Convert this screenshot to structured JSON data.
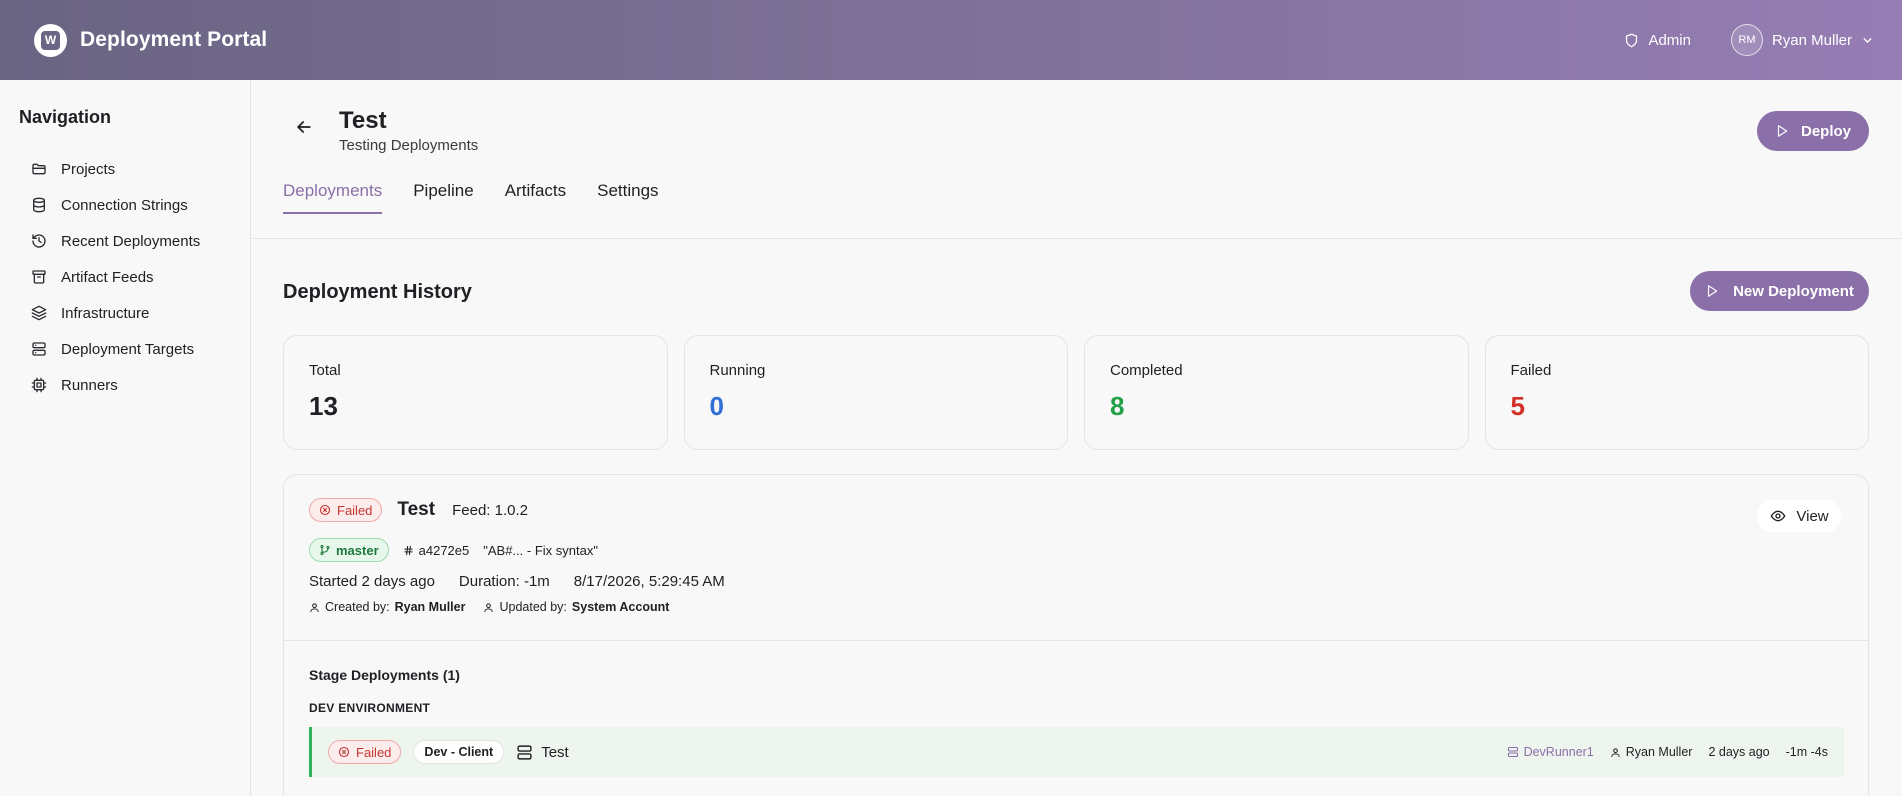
{
  "header": {
    "brand_letter": "W",
    "title": "Deployment Portal",
    "admin_label": "Admin",
    "user_initials": "RM",
    "user_name": "Ryan Muller"
  },
  "sidebar": {
    "title": "Navigation",
    "items": [
      {
        "label": "Projects",
        "icon": "folder-icon"
      },
      {
        "label": "Connection Strings",
        "icon": "database-icon"
      },
      {
        "label": "Recent Deployments",
        "icon": "history-icon"
      },
      {
        "label": "Artifact Feeds",
        "icon": "archive-icon"
      },
      {
        "label": "Infrastructure",
        "icon": "layers-icon"
      },
      {
        "label": "Deployment Targets",
        "icon": "server-icon"
      },
      {
        "label": "Runners",
        "icon": "cpu-icon"
      }
    ]
  },
  "page": {
    "title": "Test",
    "subtitle": "Testing Deployments",
    "deploy_label": "Deploy",
    "tabs": [
      "Deployments",
      "Pipeline",
      "Artifacts",
      "Settings"
    ],
    "active_tab": "Deployments"
  },
  "history": {
    "title": "Deployment History",
    "new_deployment_label": "New Deployment",
    "stats": [
      {
        "label": "Total",
        "value": "13",
        "color": "#1f1f24"
      },
      {
        "label": "Running",
        "value": "0",
        "color": "#2f6fd6"
      },
      {
        "label": "Completed",
        "value": "8",
        "color": "#22a04a"
      },
      {
        "label": "Failed",
        "value": "5",
        "color": "#d22f27"
      }
    ]
  },
  "deployment": {
    "status": "Failed",
    "name": "Test",
    "feed": "Feed: 1.0.2",
    "branch": "master",
    "commit_hash": "a4272e5",
    "commit_message": "\"AB#... - Fix syntax\"",
    "started": "Started 2 days ago",
    "duration": "Duration: -1m",
    "timestamp": "8/17/2026, 5:29:45 AM",
    "created_by_label": "Created by:",
    "created_by": "Ryan Muller",
    "updated_by_label": "Updated by:",
    "updated_by": "System Account",
    "view_label": "View",
    "stages_title": "Stage Deployments (1)",
    "environment": "DEV ENVIRONMENT",
    "stage": {
      "status": "Failed",
      "env_badge": "Dev - Client",
      "target": "Test",
      "runner": "DevRunner1",
      "user": "Ryan Muller",
      "time": "2 days ago",
      "duration": "-1m -4s"
    }
  },
  "colors": {
    "accent": "#8b6fa8",
    "failed": "#c6352f",
    "success": "#31b35c"
  }
}
